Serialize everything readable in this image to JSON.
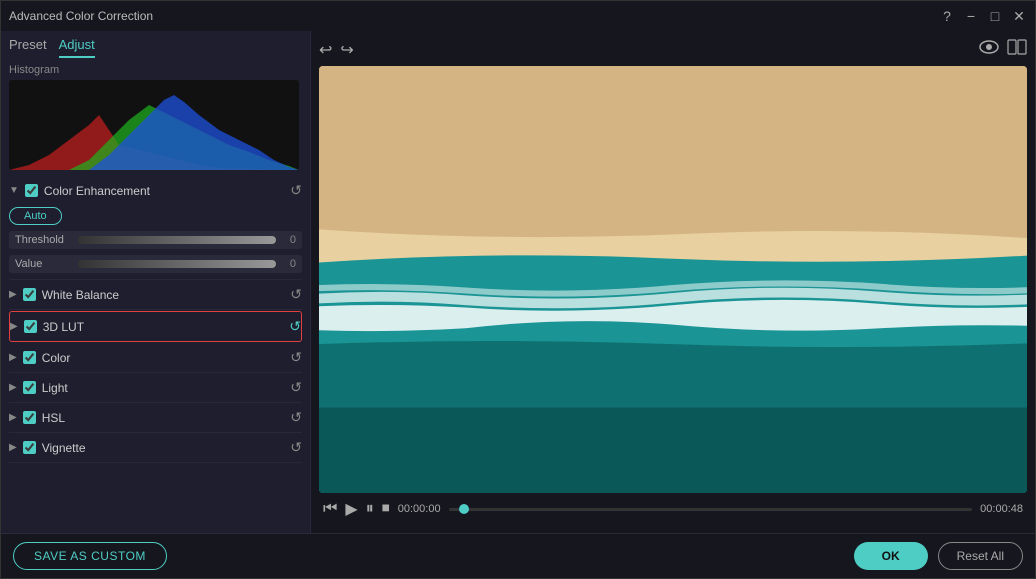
{
  "window": {
    "title": "Advanced Color Correction"
  },
  "tabs": [
    {
      "id": "preset",
      "label": "Preset",
      "active": false
    },
    {
      "id": "adjust",
      "label": "Adjust",
      "active": true
    }
  ],
  "toolbar": {
    "undo_label": "↩",
    "redo_label": "↪",
    "eye_label": "👁",
    "split_label": "⧉"
  },
  "histogram": {
    "label": "Histogram"
  },
  "color_enhancement": {
    "label": "Color Enhancement",
    "auto_btn": "Auto",
    "threshold_label": "Threshold",
    "threshold_value": "0",
    "value_label": "Value",
    "value_value": "0"
  },
  "sections": [
    {
      "id": "white-balance",
      "label": "White Balance",
      "highlighted": false,
      "checked": true
    },
    {
      "id": "3d-lut",
      "label": "3D LUT",
      "highlighted": true,
      "checked": true
    },
    {
      "id": "color",
      "label": "Color",
      "highlighted": false,
      "checked": true
    },
    {
      "id": "light",
      "label": "Light",
      "highlighted": false,
      "checked": true
    },
    {
      "id": "hsl",
      "label": "HSL",
      "highlighted": false,
      "checked": true
    },
    {
      "id": "vignette",
      "label": "Vignette",
      "highlighted": false,
      "checked": true
    }
  ],
  "video": {
    "time_start": "00:00:00",
    "time_end": "00:00:48"
  },
  "bottom": {
    "save_custom_label": "SAVE AS CUSTOM",
    "ok_label": "OK",
    "reset_all_label": "Reset All"
  },
  "title_controls": {
    "help": "?",
    "minimize": "−",
    "maximize": "□",
    "close": "✕"
  }
}
